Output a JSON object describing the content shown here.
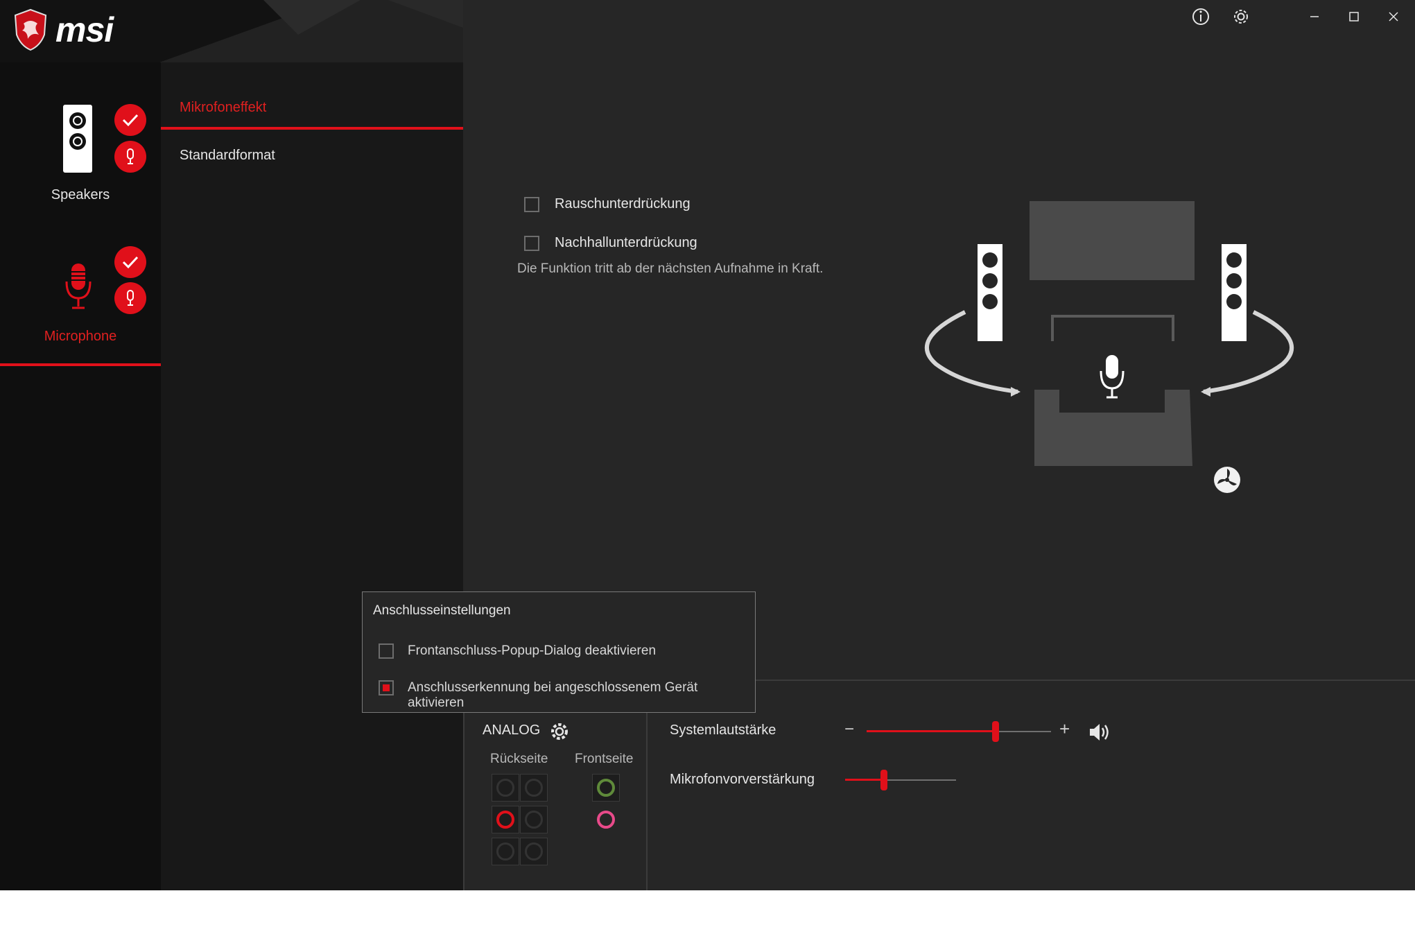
{
  "brand": {
    "logo_text": "msi"
  },
  "titlebar": {
    "info_icon": "info-icon",
    "settings_icon": "gear-icon",
    "minimize_icon": "minimize-icon",
    "maximize_icon": "maximize-icon",
    "close_icon": "close-icon"
  },
  "devices": [
    {
      "label": "Speakers",
      "selected": false
    },
    {
      "label": "Microphone",
      "selected": true
    }
  ],
  "tabs": {
    "mic_effect": "Mikrofoneffekt",
    "default_format": "Standardformat"
  },
  "effects": {
    "noise_suppression": {
      "label": "Rauschunterdrückung",
      "checked": false
    },
    "echo_cancel": {
      "label": "Nachhallunterdrückung",
      "checked": false
    },
    "note": "Die Funktion tritt ab der nächsten Aufnahme in Kraft."
  },
  "popup": {
    "title": "Anschlusseinstellungen",
    "option1": {
      "label": "Frontanschluss-Popup-Dialog deaktivieren",
      "checked": false
    },
    "option2": {
      "label": "Anschlusserkennung bei angeschlossenem Gerät aktivieren",
      "checked": true
    }
  },
  "analog": {
    "title": "ANALOG",
    "rear_label": "Rückseite",
    "front_label": "Frontseite"
  },
  "volume": {
    "system_label": "Systemlautstärke",
    "system_level": 0.7,
    "minus": "−",
    "plus": "+",
    "mic_boost_label": "Mikrofonvorverstärkung",
    "mic_boost_level": 0.35
  },
  "colors": {
    "accent": "#e0101a",
    "jack_green": "#5f8a3a",
    "jack_pink": "#e84a8a"
  }
}
